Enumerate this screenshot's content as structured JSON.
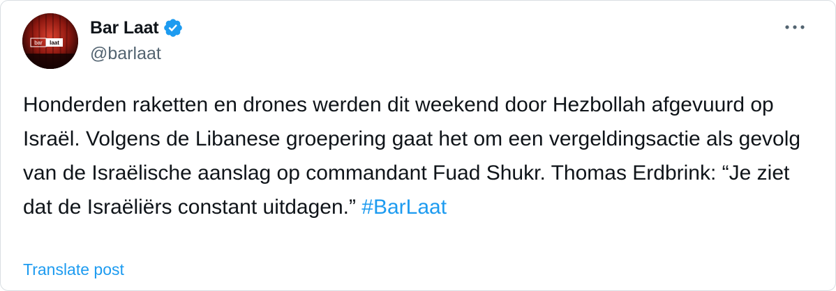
{
  "account": {
    "display_name": "Bar Laat",
    "handle": "@barlaat",
    "avatar_text_left": "bar",
    "avatar_text_right": "laat"
  },
  "tweet": {
    "text": "Honderden raketten en drones werden dit weekend door Hezbollah afgevuurd op Israël. Volgens de Libanese groepering gaat het om een vergeldingsactie als gevolg van de Israëlische aanslag op commandant Fuad Shukr. Thomas Erdbrink: “Je ziet dat de Israëliërs constant uitdagen.”",
    "hashtag": "#BarLaat"
  },
  "actions": {
    "translate_label": "Translate post"
  },
  "icons": {
    "verified": "verified-badge-icon",
    "more": "more-options-icon"
  },
  "colors": {
    "link": "#1d9bf0",
    "text_primary": "#0f1419",
    "text_secondary": "#536471",
    "verified_badge": "#1d9bf0"
  }
}
